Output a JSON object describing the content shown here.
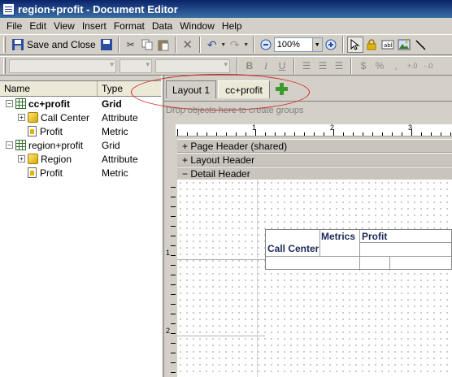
{
  "window": {
    "title": "region+profit - Document Editor"
  },
  "menu": [
    "File",
    "Edit",
    "View",
    "Insert",
    "Format",
    "Data",
    "Window",
    "Help"
  ],
  "toolbar": {
    "save_label": "Save and Close",
    "zoom_value": "100%"
  },
  "format_toolbar": {
    "bold": "B",
    "italic": "I",
    "underline": "U",
    "currency": "$",
    "percent": "%",
    "comma": ",",
    "inc_decimals": "+.0",
    "dec_decimals": "-.0"
  },
  "tree": {
    "headers": {
      "name": "Name",
      "type": "Type"
    },
    "rows": [
      {
        "label": "cc+profit",
        "type": "Grid",
        "level": 0,
        "bold": true,
        "icon": "grid-icon",
        "expander": "−"
      },
      {
        "label": "Call Center",
        "type": "Attribute",
        "level": 1,
        "bold": false,
        "icon": "attribute-icon",
        "expander": "+"
      },
      {
        "label": "Profit",
        "type": "Metric",
        "level": 1,
        "bold": false,
        "icon": "metric-icon",
        "expander": ""
      },
      {
        "label": "region+profit",
        "type": "Grid",
        "level": 0,
        "bold": false,
        "icon": "grid-icon",
        "expander": "−"
      },
      {
        "label": "Region",
        "type": "Attribute",
        "level": 1,
        "bold": false,
        "icon": "attribute-icon",
        "expander": "+"
      },
      {
        "label": "Profit",
        "type": "Metric",
        "level": 1,
        "bold": false,
        "icon": "metric-icon",
        "expander": ""
      }
    ]
  },
  "tabs": [
    {
      "label": "Layout 1",
      "active": false
    },
    {
      "label": "cc+profit",
      "active": true
    }
  ],
  "drop_hint": "Drop objects here to create groups",
  "ruler": {
    "h_labels": [
      "1",
      "2",
      "3"
    ],
    "v_labels": [
      "1",
      "2"
    ]
  },
  "sections": [
    "+ Page Header (shared)",
    "+ Layout Header",
    "− Detail Header"
  ],
  "grid_object": {
    "metrics": "Metrics",
    "profit": "Profit",
    "call_center": "Call Center"
  },
  "colors": {
    "title_bar": "#0a246a",
    "annotation": "#d02020",
    "add_tab": "#3c9a2c"
  }
}
